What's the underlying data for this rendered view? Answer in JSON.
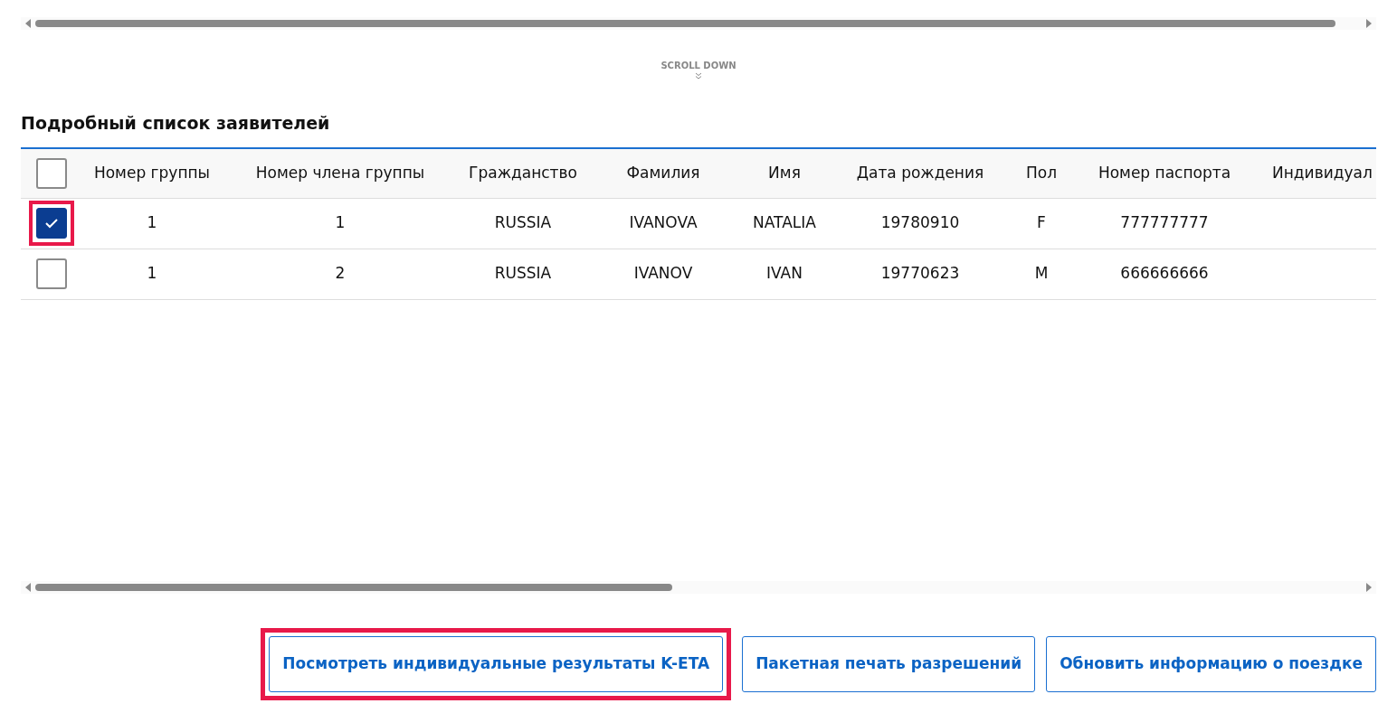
{
  "scroll_hint": {
    "label": "SCROLL DOWN"
  },
  "section_title": "Подробный список заявителей",
  "table": {
    "select_all": {
      "checked": false
    },
    "columns": [
      "Номер группы",
      "Номер члена группы",
      "Гражданство",
      "Фамилия",
      "Имя",
      "Дата рождения",
      "Пол",
      "Номер паспорта",
      "Индивидуал"
    ],
    "rows": [
      {
        "checked": true,
        "highlighted": true,
        "cells": [
          "1",
          "1",
          "RUSSIA",
          "IVANOVA",
          "NATALIA",
          "19780910",
          "F",
          "777777777",
          ""
        ]
      },
      {
        "checked": false,
        "highlighted": false,
        "cells": [
          "1",
          "2",
          "RUSSIA",
          "IVANOV",
          "IVAN",
          "19770623",
          "M",
          "666666666",
          ""
        ]
      }
    ]
  },
  "buttons": [
    {
      "label": "Посмотреть индивидуальные результаты K-ETA",
      "highlighted": true
    },
    {
      "label": "Пакетная печать разрешений",
      "highlighted": false
    },
    {
      "label": "Обновить информацию о поездке",
      "highlighted": false
    }
  ]
}
